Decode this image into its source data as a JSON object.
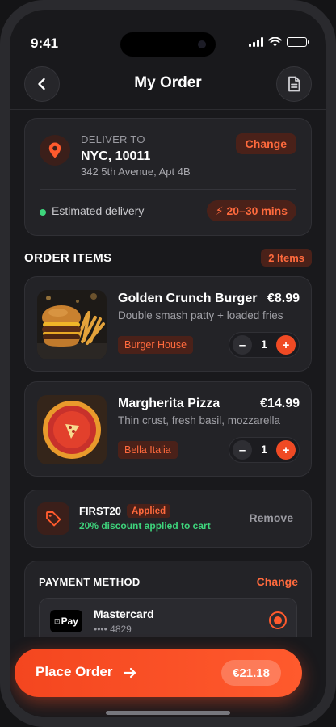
{
  "status_bar": {
    "time": "9:41"
  },
  "header": {
    "title": "My Order",
    "back_icon": "chevron-left-icon",
    "doc_icon": "document-icon"
  },
  "delivery": {
    "label": "DELIVER TO",
    "city": "NYC, 10011",
    "address": "342 5th Avenue, Apt 4B",
    "change_label": "Change",
    "estimated_label": "Estimated delivery",
    "eta": "⚡ 20–30 mins"
  },
  "order_items": {
    "title": "ORDER ITEMS",
    "count": "2 Items",
    "items": [
      {
        "name": "Golden Crunch Burger",
        "price": "€8.99",
        "description": "Double smash patty + loaded fries",
        "restaurant": "Burger House",
        "quantity": "1",
        "minus": "–",
        "plus": "+"
      },
      {
        "name": "Margherita Pizza",
        "price": "€14.99",
        "description": "Thin crust, fresh basil, mozzarella",
        "restaurant": "Bella Italia",
        "quantity": "1",
        "minus": "–",
        "plus": "+"
      }
    ]
  },
  "promo": {
    "code": "FIRST20",
    "status": "Applied",
    "message": "20% discount applied to cart",
    "remove_label": "Remove"
  },
  "payment": {
    "title": "PAYMENT METHOD",
    "change_label": "Change",
    "method_name": "Mastercard",
    "method_number": "•••• 4829",
    "logo_text": "Pay"
  },
  "cta": {
    "label": "Place Order",
    "total": "€21.18"
  },
  "colors": {
    "accent": "#ff5a2d",
    "success": "#3ed47c",
    "background": "#19191c"
  }
}
